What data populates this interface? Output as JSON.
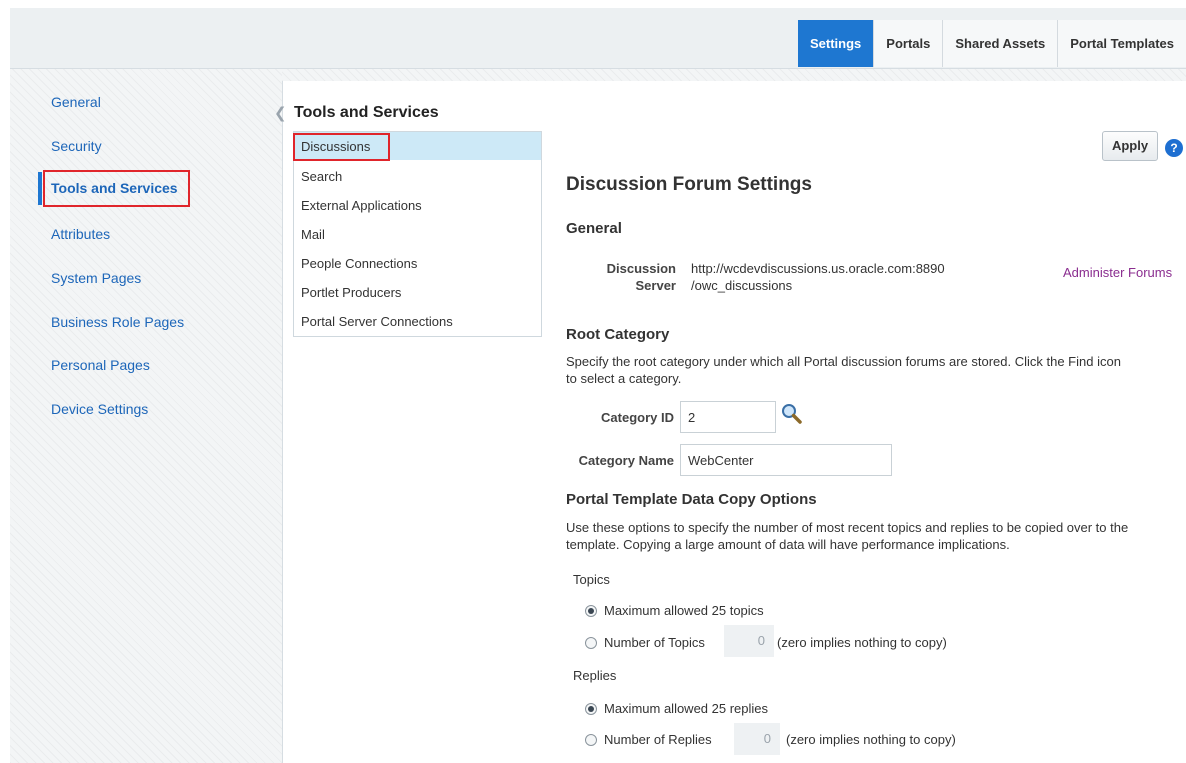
{
  "tabs": [
    {
      "label": "Settings",
      "active": true
    },
    {
      "label": "Portals",
      "active": false
    },
    {
      "label": "Shared Assets",
      "active": false
    },
    {
      "label": "Portal Templates",
      "active": false
    }
  ],
  "sidebar": {
    "items": [
      {
        "label": "General"
      },
      {
        "label": "Security"
      },
      {
        "label": "Tools and Services",
        "active": true
      },
      {
        "label": "Attributes"
      },
      {
        "label": "System Pages"
      },
      {
        "label": "Business Role Pages"
      },
      {
        "label": "Personal Pages"
      },
      {
        "label": "Device Settings"
      }
    ]
  },
  "panel": {
    "title": "Tools and Services",
    "services": [
      {
        "label": "Discussions",
        "selected": true
      },
      {
        "label": "Search"
      },
      {
        "label": "External Applications"
      },
      {
        "label": "Mail"
      },
      {
        "label": "People Connections"
      },
      {
        "label": "Portlet Producers"
      },
      {
        "label": "Portal Server Connections"
      }
    ]
  },
  "main": {
    "apply_label": "Apply",
    "help_glyph": "?",
    "heading": "Discussion Forum Settings",
    "general": {
      "title": "General",
      "server_label_1": "Discussion",
      "server_label_2": "Server",
      "server_value_1": "http://wcdevdiscussions.us.oracle.com:8890",
      "server_value_2": "/owc_discussions",
      "administer_link": "Administer Forums"
    },
    "root_category": {
      "title": "Root Category",
      "desc_1": "Specify the root category under which all Portal discussion forums are stored. Click the Find icon",
      "desc_2": "to select a category.",
      "category_id_label": "Category ID",
      "category_id_value": "2",
      "category_name_label": "Category Name",
      "category_name_value": "WebCenter"
    },
    "copy_options": {
      "title": "Portal Template Data Copy Options",
      "desc_1": "Use these options to specify the number of most recent topics and replies to be copied over to the",
      "desc_2": "template. Copying a large amount of data will have performance implications.",
      "topics_label": "Topics",
      "topics_max": "Maximum allowed 25 topics",
      "topics_number_label": "Number of Topics",
      "topics_number_value": "0",
      "topics_hint": "(zero implies nothing to copy)",
      "replies_label": "Replies",
      "replies_max": "Maximum allowed 25 replies",
      "replies_number_label": "Number of Replies",
      "replies_number_value": "0",
      "replies_hint": "(zero implies nothing to copy)"
    }
  },
  "colors": {
    "accent": "#1e77d1",
    "link": "#1d66b9",
    "visited_link": "#8a2d8f",
    "highlight_box": "#e0252b"
  }
}
